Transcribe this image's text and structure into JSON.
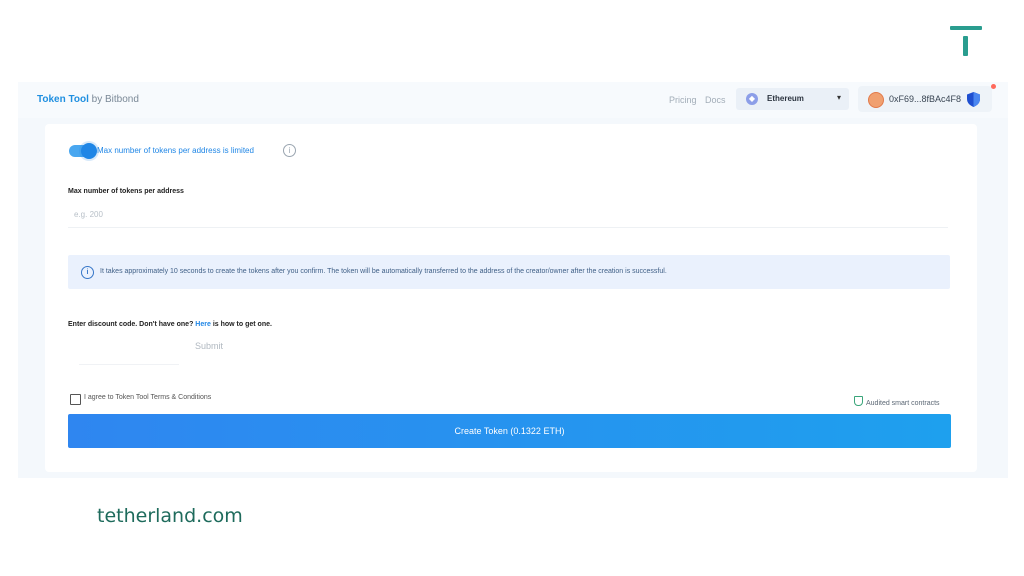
{
  "watermark": {
    "logo_icon": "tetherland-t-logo-icon",
    "caption": "tetherland.com",
    "color": "#2a9d8f"
  },
  "header": {
    "brand_name": "Token Tool",
    "brand_suffix": " by Bitbond",
    "nav": {
      "pricing": "Pricing",
      "docs": "Docs"
    },
    "network": {
      "label": "Ethereum",
      "icon": "ethereum-icon",
      "caret": "▾"
    },
    "wallet": {
      "address": "0xF69...8fBAc4F8",
      "avatar_icon": "fox-avatar-icon",
      "shield_icon": "shield-icon"
    }
  },
  "form": {
    "limit_toggle": {
      "label": "Max number of tokens per address is limited",
      "on": true,
      "info_icon": "i"
    },
    "max_tokens": {
      "label": "Max number of tokens per address",
      "placeholder": "e.g. 200",
      "value": ""
    },
    "notice": {
      "icon": "i",
      "text": "It takes approximately 10 seconds to create the tokens after you confirm. The token will be automatically transferred to the address of the creator/owner after the creation is successful."
    },
    "discount": {
      "label_prefix": "Enter discount code. Don't have one? ",
      "link": "Here",
      "label_suffix": " is how to get one.",
      "submit": "Submit"
    },
    "terms": {
      "label": "I agree to Token Tool Terms & Conditions",
      "checked": false
    },
    "audited": "Audited smart contracts",
    "create_button": "Create Token (0.1322 ETH)"
  },
  "colors": {
    "accent": "#1f86e6",
    "button_start": "#2f86f0",
    "button_end": "#1ea0ee"
  }
}
